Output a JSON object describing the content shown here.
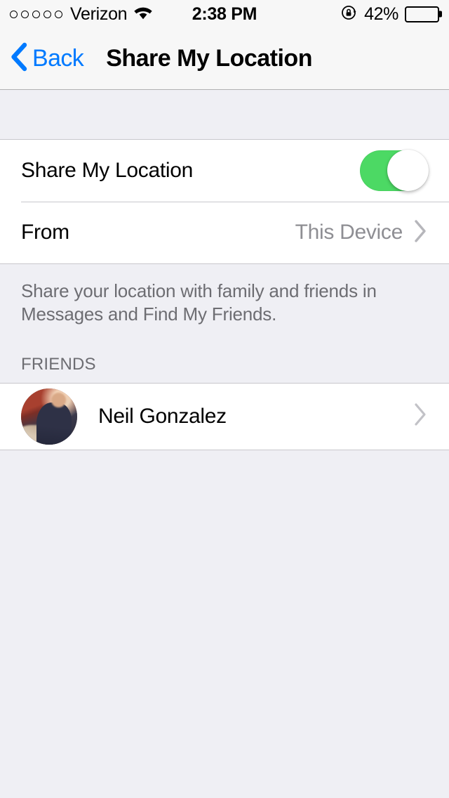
{
  "status_bar": {
    "carrier": "Verizon",
    "signal_dots": 5,
    "signal_filled": 0,
    "wifi_icon": "wifi-icon",
    "time": "2:38 PM",
    "rotation_lock_icon": "rotation-lock-icon",
    "battery_percent_label": "42%",
    "battery_level": 42
  },
  "nav": {
    "back_label": "Back",
    "back_icon": "chevron-left-icon",
    "title": "Share My Location"
  },
  "settings": {
    "share_row": {
      "label": "Share My Location",
      "toggle_on": true,
      "toggle_color": "#4CD964"
    },
    "from_row": {
      "label": "From",
      "value": "This Device",
      "chevron_icon": "chevron-right-icon"
    },
    "footer_text": "Share your location with family and friends in Messages and Find My Friends."
  },
  "friends": {
    "header": "FRIENDS",
    "items": [
      {
        "name": "Neil Gonzalez",
        "avatar": "contact-photo",
        "chevron_icon": "chevron-right-icon"
      }
    ]
  },
  "colors": {
    "accent_blue": "#007AFF",
    "toggle_green": "#4CD964",
    "group_background": "#EFEFF4",
    "cell_background": "#FFFFFF",
    "secondary_text": "#8E8E93",
    "header_text": "#6D6D72"
  }
}
